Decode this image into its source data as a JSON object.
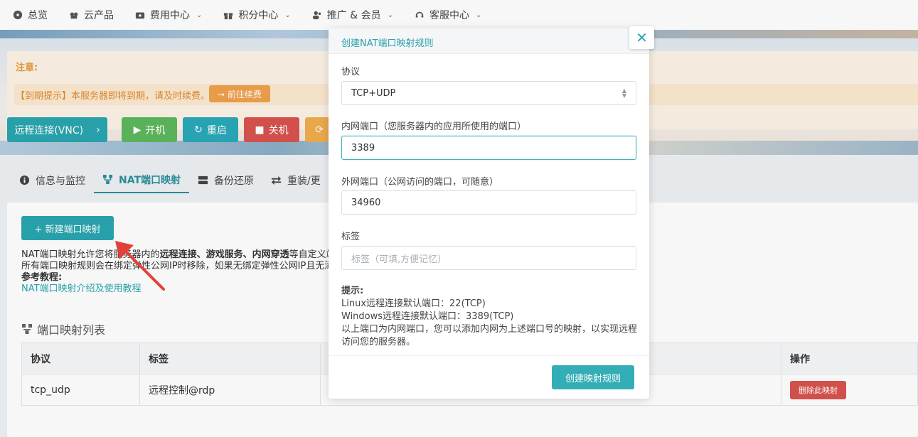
{
  "topnav": {
    "items": [
      {
        "label": "总览",
        "icon": "dashboard-icon",
        "dropdown": false
      },
      {
        "label": "云产品",
        "icon": "cloud-icon",
        "dropdown": false
      },
      {
        "label": "费用中心",
        "icon": "wallet-icon",
        "dropdown": true
      },
      {
        "label": "积分中心",
        "icon": "gift-icon",
        "dropdown": true
      },
      {
        "label": "推广 & 会员",
        "icon": "users-icon",
        "dropdown": true
      },
      {
        "label": "客服中心",
        "icon": "headset-icon",
        "dropdown": true
      }
    ]
  },
  "notice": {
    "title": "注意:",
    "text": "【到期提示】本服务器即将到期，请及时续费。",
    "renew_label": "→ 前往续费"
  },
  "ops": {
    "vnc_label": "远程连接(VNC)",
    "start_label": "开机",
    "restart_label": "重启",
    "shutdown_label": "关机"
  },
  "tabs": [
    {
      "label": "信息与监控",
      "icon": "info-icon",
      "active": false
    },
    {
      "label": "NAT端口映射",
      "icon": "network-icon",
      "active": true
    },
    {
      "label": "备份还原",
      "icon": "storage-icon",
      "active": false
    },
    {
      "label": "重装/更",
      "icon": "swap-icon",
      "active": false
    }
  ],
  "panel": {
    "add_label": "+ 新建端口映射",
    "desc_line1_a": "NAT端口映射允许您将服务器内的",
    "desc_line1_b": "远程连接、游戏服务、内网穿透",
    "desc_line1_c": "等自定义端",
    "desc_line2": "所有端口映射规则会在绑定弹性公网IP时移除，如果无绑定弹性公网IP且无添加",
    "ref_label": "参考教程:",
    "ref_link": "NAT端口映射介绍及使用教程",
    "list_title": "端口映射列表",
    "columns": [
      "协议",
      "标签",
      "",
      "操作"
    ],
    "rows": [
      {
        "protocol": "tcp_udp",
        "tag": "远程控制@rdp",
        "action": "删除此映射"
      }
    ]
  },
  "modal": {
    "title": "创建NAT端口映射规则",
    "close_label": "✕",
    "protocol_label": "协议",
    "protocol_value": "TCP+UDP",
    "inner_port_label": "内网端口（您服务器内的应用所使用的端口）",
    "inner_port_value": "3389",
    "outer_port_label": "外网端口（公网访问的端口，可随意）",
    "outer_port_value": "34960",
    "tag_label": "标签",
    "tag_placeholder": "标签（可填,方便记忆）",
    "tips_title": "提示:",
    "tips_line1": "Linux远程连接默认端口：22(TCP)",
    "tips_line2": "Windows远程连接默认端口：3389(TCP)",
    "tips_line3": "以上端口为内网端口，您可以添加内网为上述端口号的映射，以实现远程访问您的服务器。",
    "submit_label": "创建映射规则"
  },
  "colors": {
    "accent": "#2aa6b0",
    "danger": "#d9534f",
    "warning": "#f0a04b",
    "success": "#5cb85c"
  }
}
